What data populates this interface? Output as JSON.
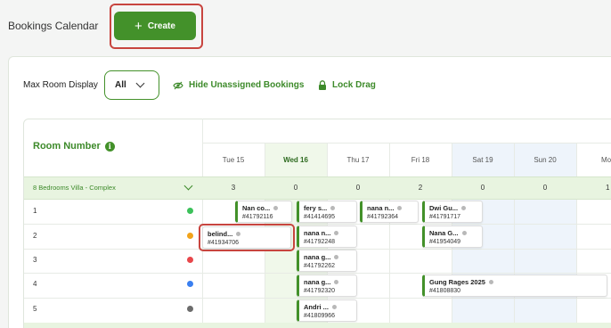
{
  "header": {
    "title": "Bookings Calendar",
    "create_label": "Create"
  },
  "toolbar": {
    "max_room_label": "Max Room Display",
    "max_room_value": "All",
    "hide_unassigned_label": "Hide Unassigned Bookings",
    "lock_drag_label": "Lock Drag"
  },
  "calendar": {
    "room_number_header": "Room Number",
    "days": [
      {
        "label": "Tue 15",
        "today": false,
        "weekend": false
      },
      {
        "label": "Wed 16",
        "today": true,
        "weekend": false
      },
      {
        "label": "Thu 17",
        "today": false,
        "weekend": false
      },
      {
        "label": "Fri 18",
        "today": false,
        "weekend": false
      },
      {
        "label": "Sat 19",
        "today": false,
        "weekend": true
      },
      {
        "label": "Sun 20",
        "today": false,
        "weekend": true
      },
      {
        "label": "Mon",
        "today": false,
        "weekend": false
      }
    ],
    "group": {
      "label": "8 Bedrooms Villa - Complex",
      "counts": [
        "3",
        "0",
        "0",
        "2",
        "0",
        "0",
        "1"
      ]
    },
    "rooms": [
      {
        "number": "1",
        "color": "#3cc15a"
      },
      {
        "number": "2",
        "color": "#f2a31a"
      },
      {
        "number": "3",
        "color": "#e8474b"
      },
      {
        "number": "4",
        "color": "#3a7ff0"
      },
      {
        "number": "5",
        "color": "#6c6c6c"
      }
    ],
    "bookings": [
      {
        "name": "Nan co...",
        "ref": "#41792116"
      },
      {
        "name": "fery s...",
        "ref": "#41414695"
      },
      {
        "name": "nana n...",
        "ref": "#41792364"
      },
      {
        "name": "Dwi Gu...",
        "ref": "#41791717"
      },
      {
        "name": "belind...",
        "ref": "#41934706"
      },
      {
        "name": "nana n...",
        "ref": "#41792248"
      },
      {
        "name": "Nana G...",
        "ref": "#41954049"
      },
      {
        "name": "nana g...",
        "ref": "#41792262"
      },
      {
        "name": "nana g...",
        "ref": "#41792320"
      },
      {
        "name": "Gung Rages 2025",
        "ref": "#41808830"
      },
      {
        "name": "Andri ...",
        "ref": "#41809966"
      }
    ]
  },
  "colors": {
    "accent": "#43912a",
    "highlight": "#c8453f",
    "weekend_bg": "#eef4fb",
    "today_bg": "#f0f8ea"
  }
}
